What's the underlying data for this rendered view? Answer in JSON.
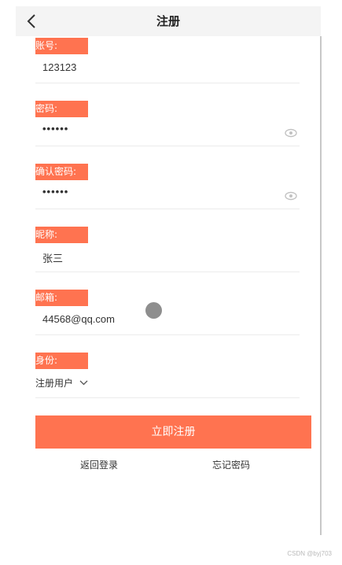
{
  "header": {
    "title": "注册",
    "back_icon": "chevron-left-icon"
  },
  "fields": {
    "account": {
      "label": "账号:",
      "value": "123123"
    },
    "password": {
      "label": "密码:",
      "value": "••••••",
      "icon": "eye-icon"
    },
    "confirm_password": {
      "label": "确认密码:",
      "value": "••••••",
      "icon": "eye-icon"
    },
    "nickname": {
      "label": "昵称:",
      "value": "张三"
    },
    "email": {
      "label": "邮箱:",
      "value": "44568@qq.com"
    },
    "role": {
      "label": "身份:",
      "value": "注册用户",
      "icon": "chevron-down-icon"
    }
  },
  "actions": {
    "submit_label": "立即注册",
    "back_login": "返回登录",
    "forgot_password": "忘记密码"
  },
  "watermark": "CSDN @byj703",
  "colors": {
    "accent": "#ff7350",
    "header_bg": "#f4f4f4"
  }
}
